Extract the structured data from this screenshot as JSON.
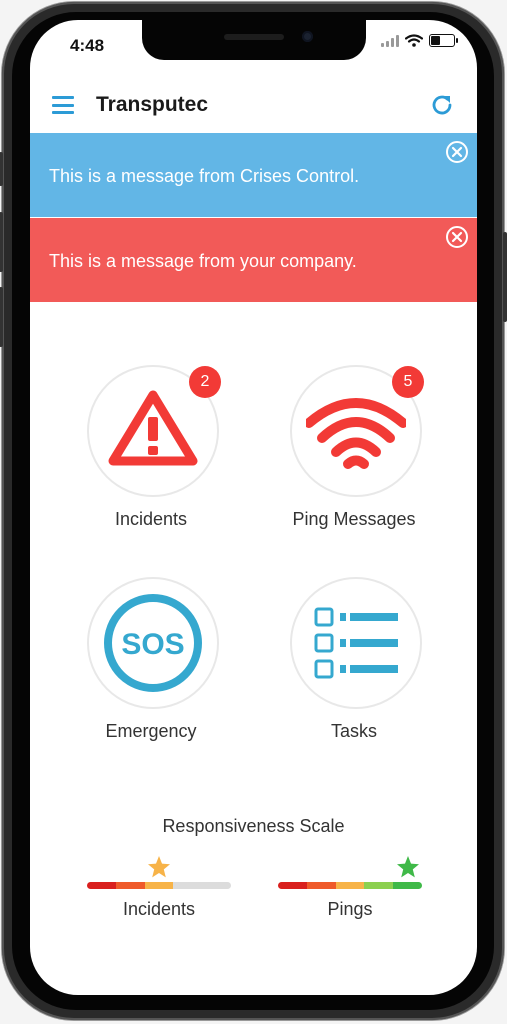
{
  "status": {
    "time": "4:48"
  },
  "header": {
    "title": "Transputec",
    "menu_icon": "hamburger-menu-icon",
    "refresh_icon": "refresh-icon"
  },
  "banners": [
    {
      "text": "This is a message from Crises Control.",
      "color": "#62b6e6"
    },
    {
      "text": "This is a message from your company.",
      "color": "#f25a58"
    }
  ],
  "tiles": [
    {
      "label": "Incidents",
      "badge": "2",
      "icon": "warning-triangle-icon"
    },
    {
      "label": "Ping Messages",
      "badge": "5",
      "icon": "wifi-signal-icon"
    },
    {
      "label": "Emergency",
      "icon": "sos-icon",
      "icon_text": "SOS"
    },
    {
      "label": "Tasks",
      "icon": "task-list-icon"
    }
  ],
  "responsiveness": {
    "title": "Responsiveness Scale",
    "scales": [
      {
        "label": "Incidents",
        "level": 3,
        "max": 5,
        "star_color": "#f7b348"
      },
      {
        "label": "Pings",
        "level": 5,
        "max": 5,
        "star_color": "#3fb948"
      }
    ],
    "segment_colors": [
      "#d9201e",
      "#ef5a2a",
      "#f7b348",
      "#8cd04f",
      "#3fb948"
    ],
    "inactive_color": "#dcdcdc"
  },
  "colors": {
    "accent": "#2c9bd6",
    "alert_red": "#f23a36",
    "sos_blue": "#35a8cf"
  }
}
